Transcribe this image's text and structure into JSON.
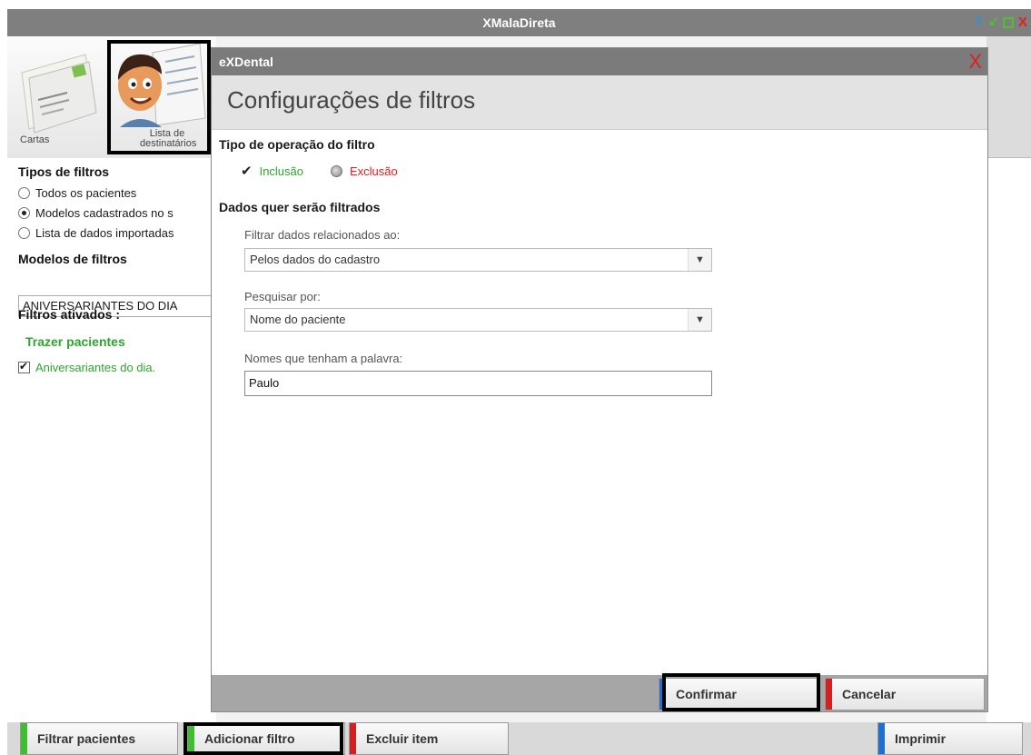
{
  "window": {
    "title": "XMalaDireta",
    "controls": {
      "help": "?",
      "minimize": "↙",
      "close": "X"
    }
  },
  "toolbar": {
    "cartas_label": "Cartas",
    "lista_label": "Lista de destinatários"
  },
  "left": {
    "tipos_title": "Tipos de filtros",
    "tipos": [
      {
        "label": "Todos os pacientes",
        "selected": false
      },
      {
        "label": "Modelos cadastrados no s",
        "selected": true
      },
      {
        "label": "Lista de dados importadas",
        "selected": false
      }
    ],
    "modelos_title": "Modelos de filtros",
    "modelos_value": "ANIVERSARIANTES DO DIA",
    "ativados_title": "Filtros ativados :",
    "trazer_label": "Trazer pacientes",
    "filtros_ativos": [
      {
        "label": "Aniversariantes do dia.",
        "checked": true
      }
    ]
  },
  "dialog": {
    "app_title": "eXDental",
    "close_symbol": "X",
    "heading": "Configurações de filtros",
    "section1": "Tipo de operação do filtro",
    "inclusao_label": "Inclusão",
    "exclusao_label": "Exclusão",
    "section2": "Dados quer serão filtrados",
    "filtrar_label": "Filtrar dados relacionados ao:",
    "filtrar_value": "Pelos dados do cadastro",
    "pesquisar_label": "Pesquisar por:",
    "pesquisar_value": "Nome do paciente",
    "nomes_label": "Nomes que tenham a palavra:",
    "nomes_value": "Paulo",
    "confirmar": "Confirmar",
    "cancelar": "Cancelar"
  },
  "bottom": {
    "filtrar": "Filtrar pacientes",
    "adicionar": "Adicionar filtro",
    "excluir": "Excluir item",
    "imprimir": "Imprimir"
  },
  "colors": {
    "green": "#2fa52f",
    "red": "#e02020",
    "blue_stripe": "#1f6fd0",
    "green_stripe": "#3fbf2f",
    "red_stripe": "#d42020"
  }
}
